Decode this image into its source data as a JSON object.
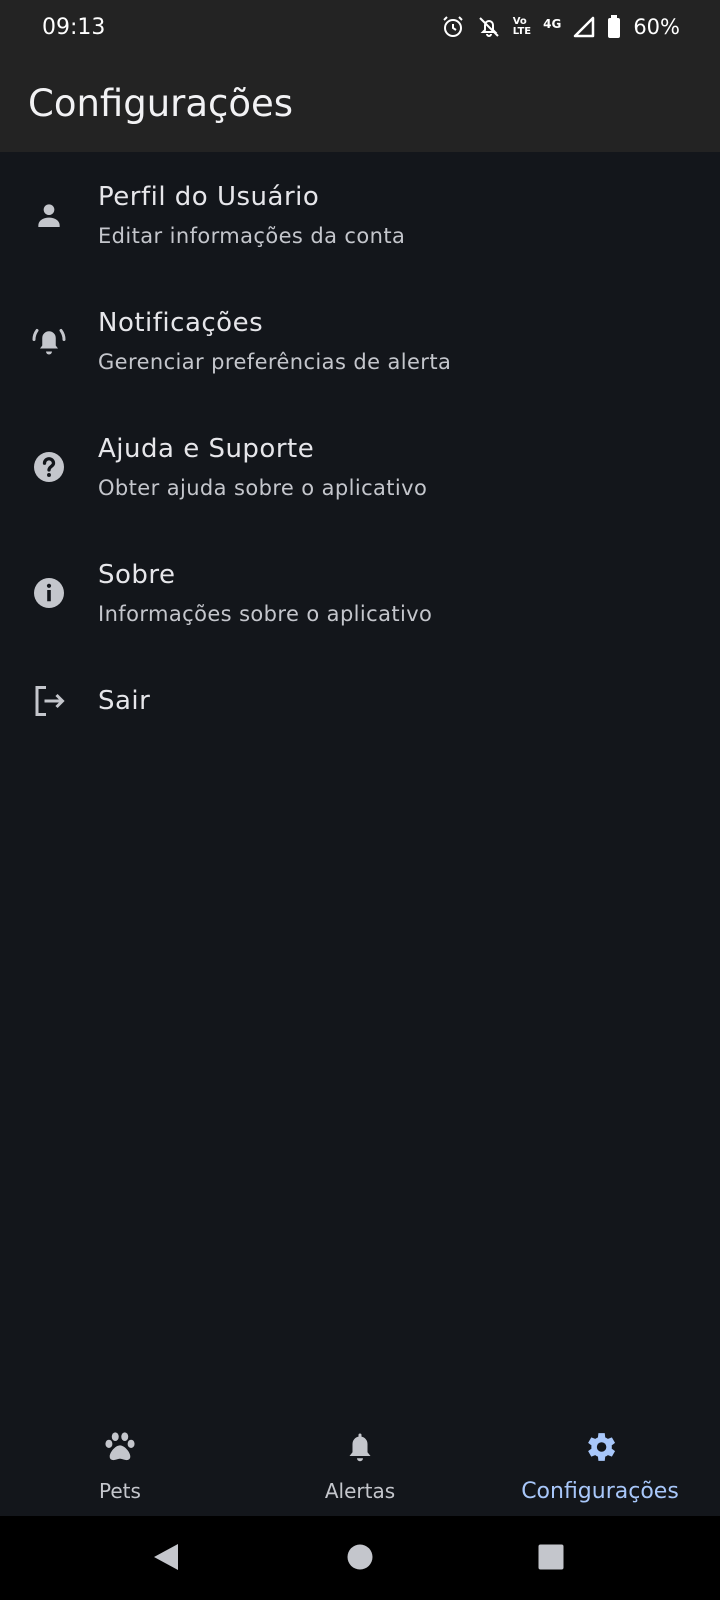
{
  "status_bar": {
    "time": "09:13",
    "volte_top": "Vo",
    "volte_bottom": "LTE",
    "network": "4G",
    "battery": "60%"
  },
  "app_bar": {
    "title": "Configurações"
  },
  "settings": [
    {
      "icon": "person-icon",
      "title": "Perfil do Usuário",
      "subtitle": "Editar informações da conta"
    },
    {
      "icon": "bell-ringing-icon",
      "title": "Notificações",
      "subtitle": "Gerenciar preferências de alerta"
    },
    {
      "icon": "help-icon",
      "title": "Ajuda e Suporte",
      "subtitle": "Obter ajuda sobre o aplicativo"
    },
    {
      "icon": "info-icon",
      "title": "Sobre",
      "subtitle": "Informações sobre o aplicativo"
    },
    {
      "icon": "logout-icon",
      "title": "Sair"
    }
  ],
  "bottom_nav": [
    {
      "icon": "paw-icon",
      "label": "Pets",
      "active": false
    },
    {
      "icon": "bell-icon",
      "label": "Alertas",
      "active": false
    },
    {
      "icon": "gear-icon",
      "label": "Configurações",
      "active": true
    }
  ],
  "colors": {
    "background": "#13161b",
    "app_bar": "#232323",
    "accent": "#a8c7fa",
    "icon": "#c4c6cc"
  }
}
